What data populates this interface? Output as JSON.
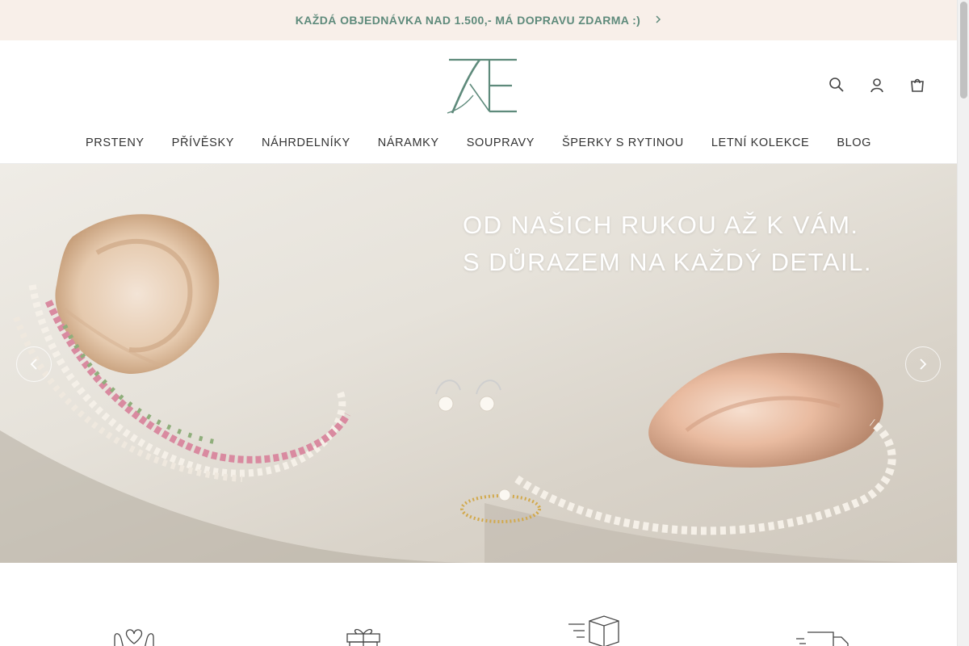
{
  "announcement": {
    "text": "KAŽDÁ OBJEDNÁVKA NAD 1.500,- MÁ DOPRAVU ZDARMA :)",
    "arrow_icon": "chevron-right-icon"
  },
  "logo": {
    "text": "7Æ",
    "color": "#5e8a7b"
  },
  "header_icons": [
    "search-icon",
    "user-icon",
    "cart-icon"
  ],
  "nav": {
    "items": [
      {
        "label": "PRSTENY"
      },
      {
        "label": "PŘÍVĚSKY"
      },
      {
        "label": "NÁHRDELNÍKY"
      },
      {
        "label": "NÁRAMKY"
      },
      {
        "label": "SOUPRAVY"
      },
      {
        "label": "ŠPERKY S RYTINOU"
      },
      {
        "label": "LETNÍ KOLEKCE"
      },
      {
        "label": "BLOG"
      }
    ]
  },
  "hero": {
    "line1": "OD NAŠICH RUKOU AŽ K VÁM.",
    "line2": "S DŮRAZEM NA KAŽDÝ DETAIL.",
    "prev_icon": "chevron-left-icon",
    "next_icon": "chevron-right-icon"
  },
  "features": {
    "icons": [
      "hands-heart-icon",
      "gift-icon",
      "package-delivery-icon",
      "truck-icon"
    ]
  },
  "colors": {
    "accent": "#5e8a7b",
    "announcement_bg": "#f8efe9",
    "nav_text": "#333333"
  }
}
